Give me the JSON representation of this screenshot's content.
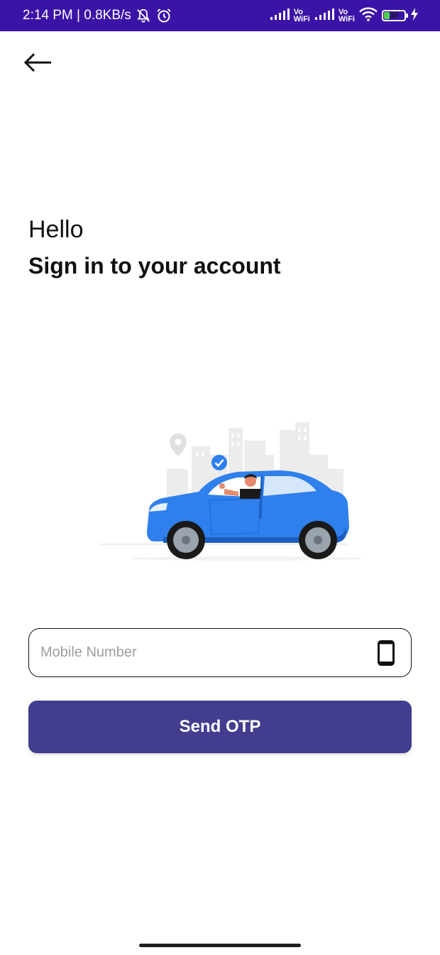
{
  "status_bar": {
    "time_speed": "2:14 PM | 0.8KB/s",
    "vowifi_1_top": "Vo",
    "vowifi_1_bottom": "WiFi",
    "vowifi_2_top": "Vo",
    "vowifi_2_bottom": "WiFi",
    "battery_level": "30",
    "battery_fraction": 0.3,
    "bar_color": "#3b14a7"
  },
  "header": {
    "back_icon": "arrow-left-icon"
  },
  "intro": {
    "greeting": "Hello",
    "title": "Sign in to your account"
  },
  "illustration": {
    "name": "car-driver-illustration",
    "car_color": "#2f80ed"
  },
  "form": {
    "mobile_placeholder": "Mobile Number",
    "mobile_value": "",
    "mobile_icon": "smartphone-icon",
    "send_otp_label": "Send OTP",
    "button_color": "#433d8f"
  }
}
